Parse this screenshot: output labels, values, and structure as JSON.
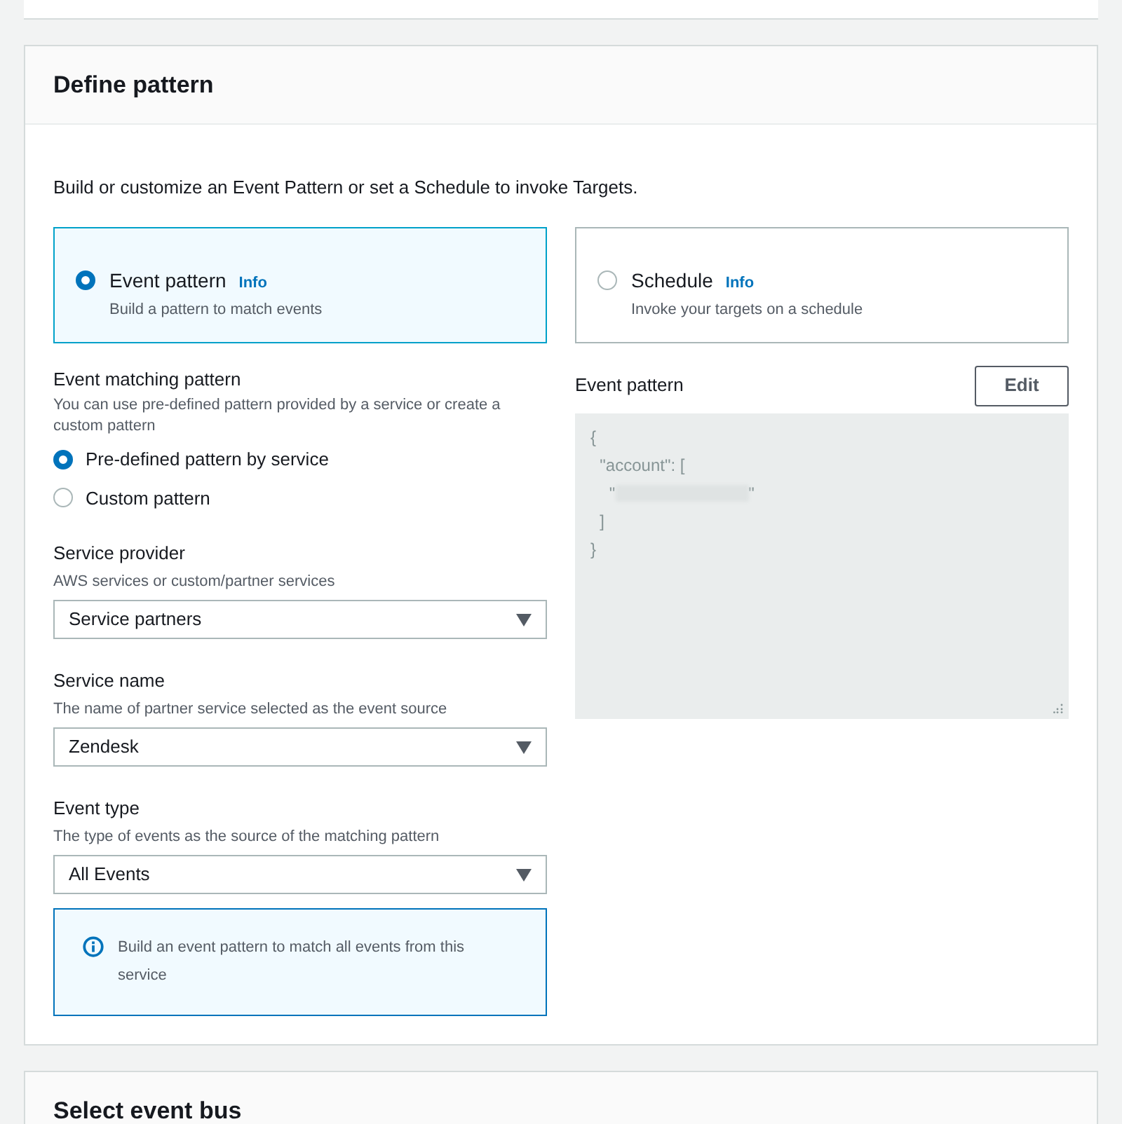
{
  "section_title": "Define pattern",
  "intro": "Build or customize an Event Pattern or set a Schedule to invoke Targets.",
  "pattern_types": [
    {
      "label": "Event pattern",
      "info": "Info",
      "description": "Build a pattern to match events",
      "selected": true
    },
    {
      "label": "Schedule",
      "info": "Info",
      "description": "Invoke your targets on a schedule",
      "selected": false
    }
  ],
  "event_matching": {
    "label": "Event matching pattern",
    "description": "You can use pre-defined pattern provided by a service or create a custom pattern",
    "options": [
      {
        "label": "Pre-defined pattern by service",
        "selected": true
      },
      {
        "label": "Custom pattern",
        "selected": false
      }
    ]
  },
  "selects": [
    {
      "label": "Service provider",
      "description": "AWS services or custom/partner services",
      "value": "Service partners"
    },
    {
      "label": "Service name",
      "description": "The name of partner service selected as the event source",
      "value": "Zendesk"
    },
    {
      "label": "Event type",
      "description": "The type of events as the source of the matching pattern",
      "value": "All Events"
    }
  ],
  "info_alert": "Build an event pattern to match all events from this service",
  "event_pattern": {
    "label": "Event pattern",
    "edit_button": "Edit",
    "code_lines": [
      {
        "kind": "text",
        "text": "{"
      },
      {
        "kind": "text",
        "text": "  \"account\": ["
      },
      {
        "kind": "redacted",
        "before": "    \"",
        "after": "\""
      },
      {
        "kind": "text",
        "text": "  ]"
      },
      {
        "kind": "text",
        "text": "}"
      }
    ]
  },
  "next_section_title": "Select event bus"
}
